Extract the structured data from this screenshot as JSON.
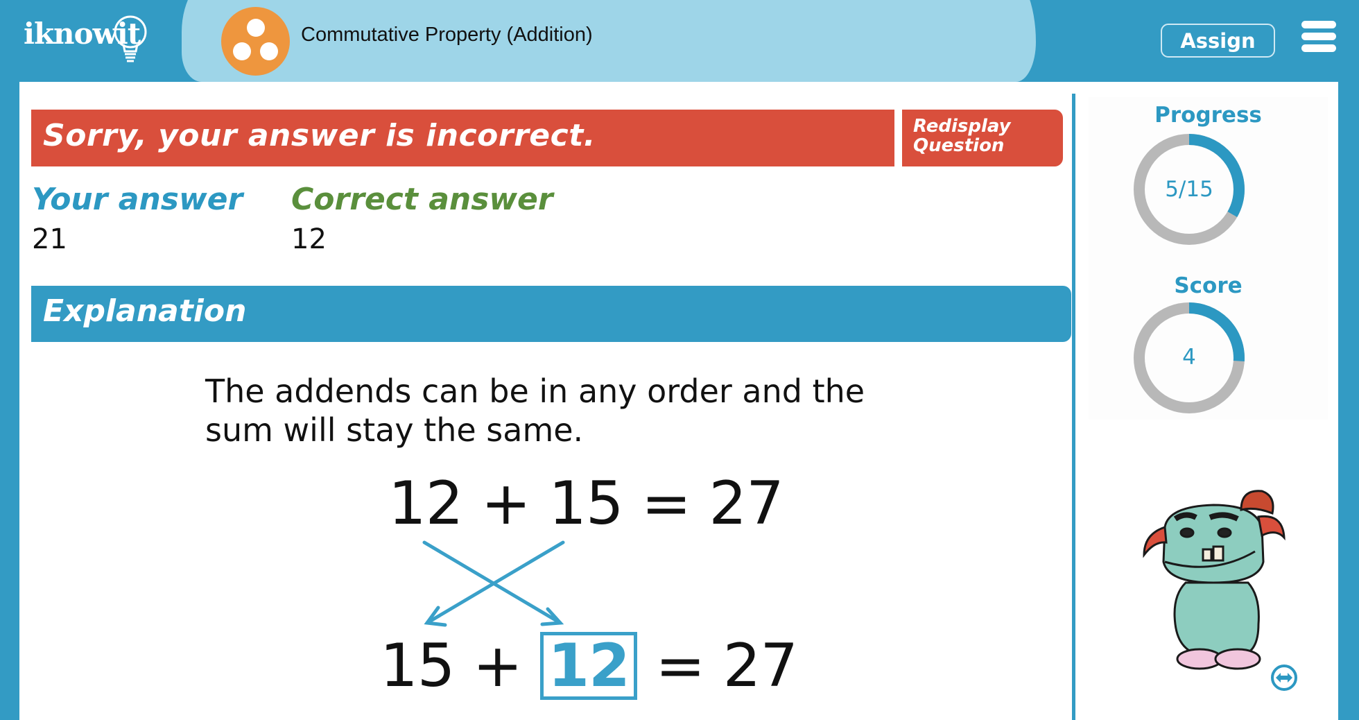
{
  "header": {
    "logo_text": "iknowit",
    "topic_title": "Commutative Property (Addition)",
    "topic_icon": "three-dots-circle-icon",
    "assign_label": "Assign",
    "menu_icon": "hamburger-menu-icon"
  },
  "feedback": {
    "message": "Sorry, your answer is incorrect.",
    "redisplay_label_line1": "Redisplay",
    "redisplay_label_line2": "Question",
    "your_answer_label": "Your answer",
    "your_answer_value": "21",
    "correct_answer_label": "Correct answer",
    "correct_answer_value": "12"
  },
  "explanation": {
    "heading": "Explanation",
    "text": "The addends can be in any order and the sum will stay the same.",
    "equation1": {
      "a": "12",
      "op": "+",
      "b": "15",
      "eq": "=",
      "sum": "27"
    },
    "equation2": {
      "a": "15",
      "op": "+",
      "b": "12",
      "eq": "=",
      "sum": "27"
    }
  },
  "sidebar": {
    "progress": {
      "label": "Progress",
      "value_text": "5/15",
      "current": 5,
      "total": 15
    },
    "score": {
      "label": "Score",
      "value_text": "4",
      "fill_fraction": 0.26
    },
    "mascot": "monster-mascot",
    "expand_icon": "expand-horizontal-icon"
  },
  "colors": {
    "brand_blue": "#339bc4",
    "title_pill": "#9ed5e8",
    "topic_orange": "#ee963e",
    "incorrect_red": "#d94f3c",
    "your_answer_blue": "#2c98c2",
    "correct_answer_green": "#5a8f3c",
    "ring_gray": "#b8b8b8"
  }
}
